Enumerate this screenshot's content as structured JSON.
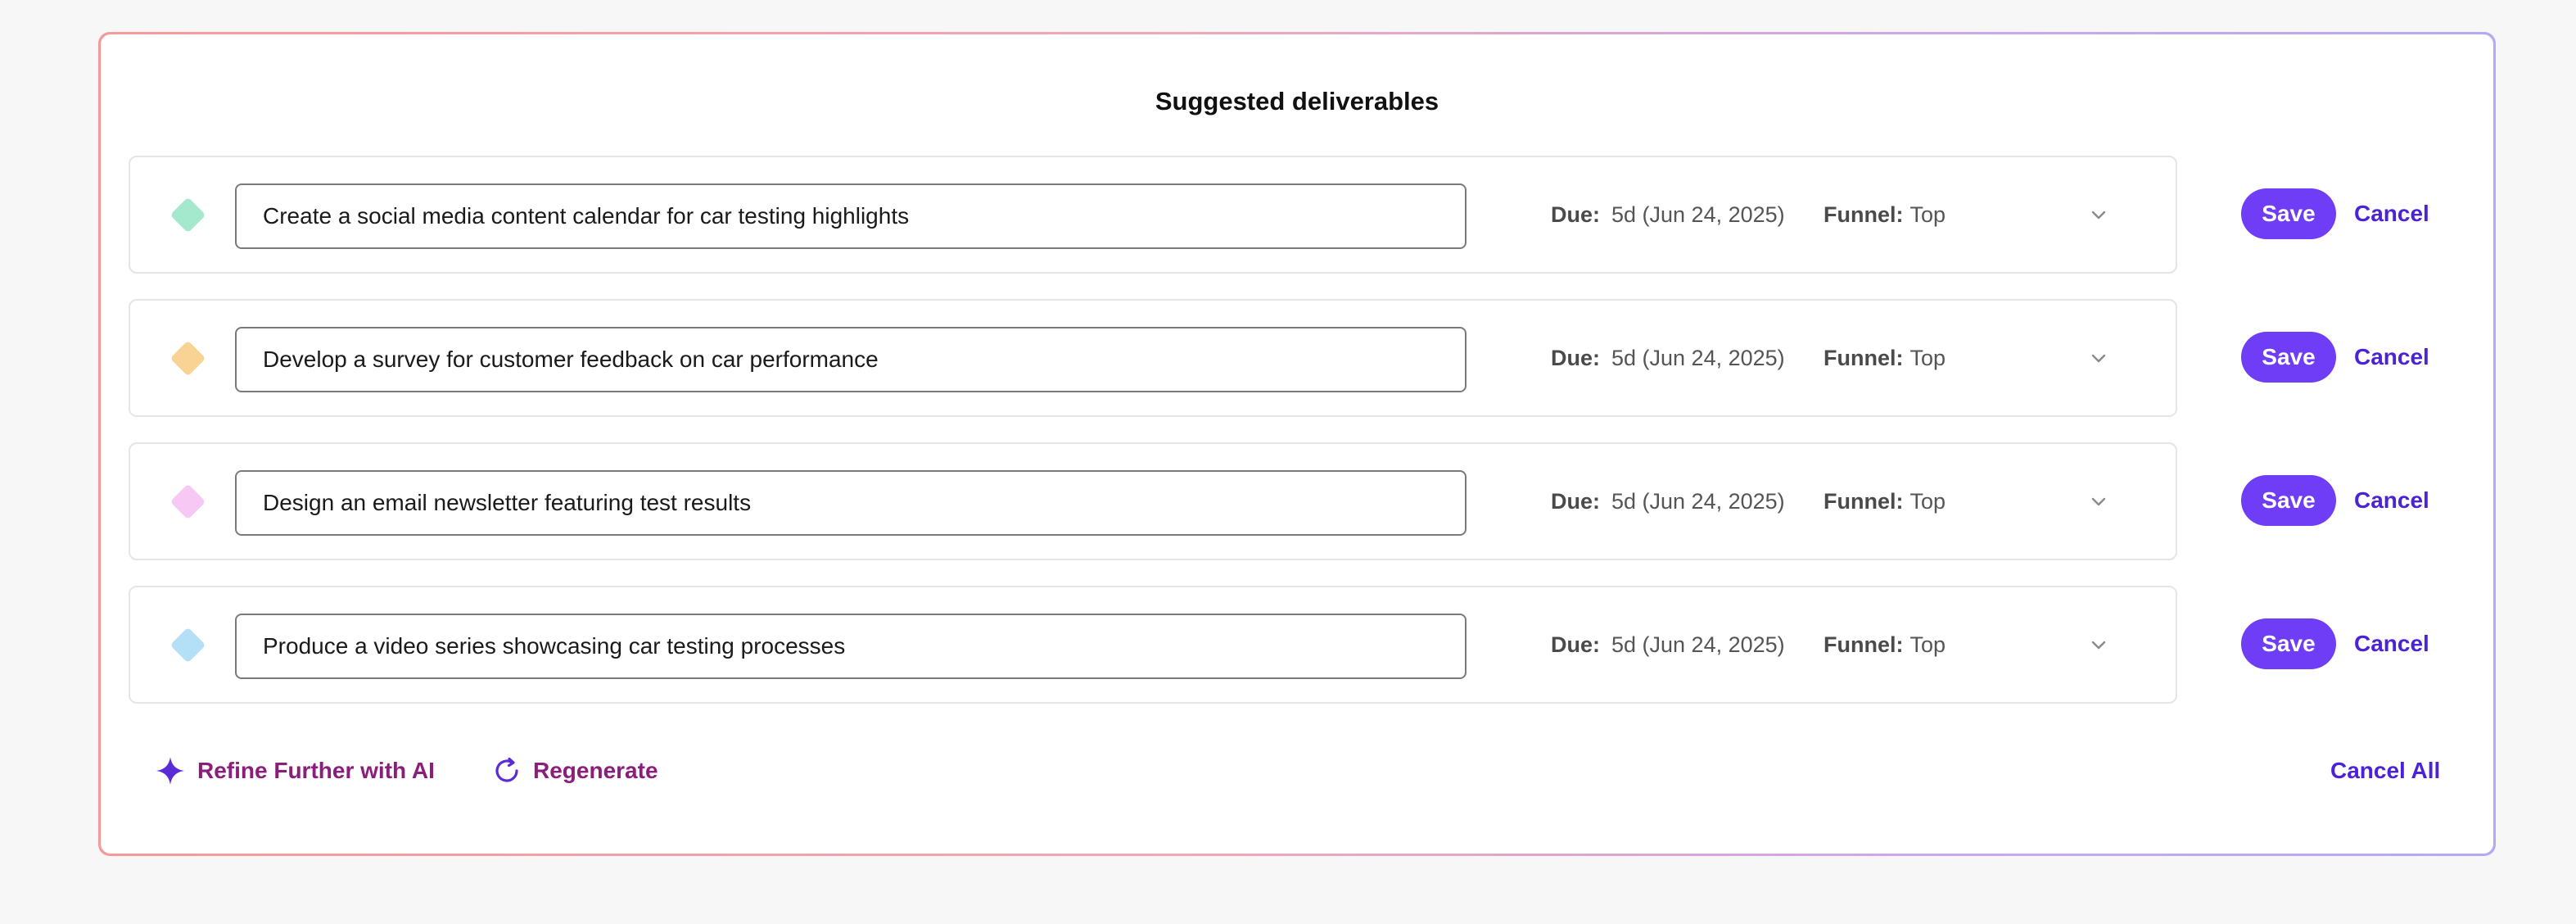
{
  "panel": {
    "title": "Suggested deliverables"
  },
  "deliverables": [
    {
      "text": "Create a social media content calendar for car testing highlights",
      "due_label": "Due:",
      "due_value": "5d (Jun 24, 2025)",
      "funnel_label": "Funnel:",
      "funnel_value": "Top",
      "marker_color": "#a4e9cd",
      "save_label": "Save",
      "cancel_label": "Cancel"
    },
    {
      "text": "Develop a survey for customer feedback on car performance",
      "due_label": "Due:",
      "due_value": "5d (Jun 24, 2025)",
      "funnel_label": "Funnel:",
      "funnel_value": "Top",
      "marker_color": "#f9d394",
      "save_label": "Save",
      "cancel_label": "Cancel"
    },
    {
      "text": "Design an email newsletter featuring test results",
      "due_label": "Due:",
      "due_value": "5d (Jun 24, 2025)",
      "funnel_label": "Funnel:",
      "funnel_value": "Top",
      "marker_color": "#f6c8f3",
      "save_label": "Save",
      "cancel_label": "Cancel"
    },
    {
      "text": "Produce a video series showcasing car testing processes",
      "due_label": "Due:",
      "due_value": "5d (Jun 24, 2025)",
      "funnel_label": "Funnel:",
      "funnel_value": "Top",
      "marker_color": "#b3e0f7",
      "save_label": "Save",
      "cancel_label": "Cancel"
    }
  ],
  "footer": {
    "refine_label": "Refine Further with AI",
    "regenerate_label": "Regenerate",
    "cancel_all_label": "Cancel All"
  },
  "colors": {
    "primary": "#6e3df5",
    "link": "#4c22d8",
    "footer_text": "#8a1e7a"
  },
  "icons": {
    "refine": "sparkle-icon",
    "regenerate": "refresh-icon",
    "funnel_dropdown": "chevron-down-icon",
    "marker": "diamond-icon"
  }
}
